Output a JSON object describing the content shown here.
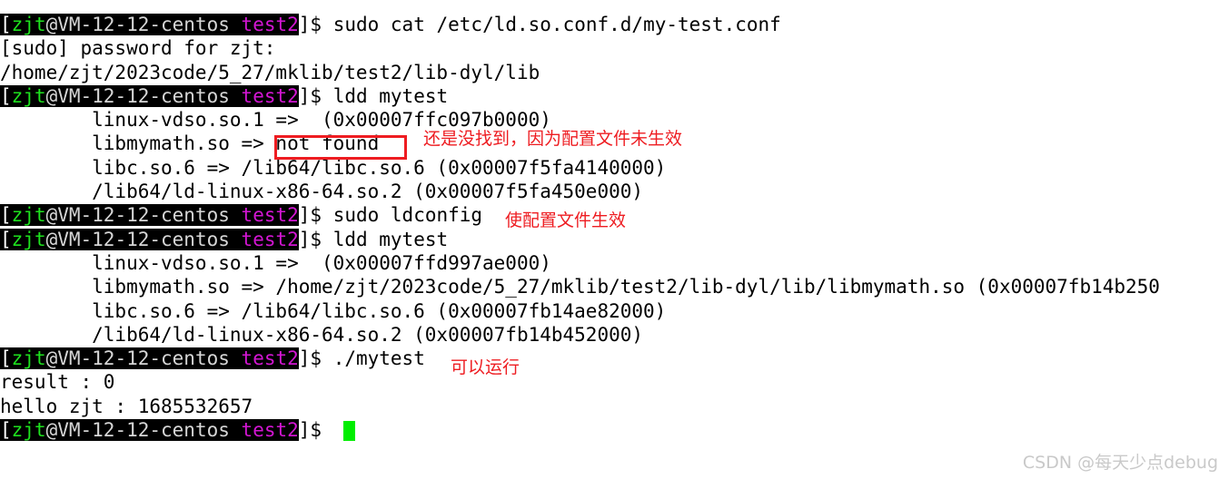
{
  "terminal": {
    "prompt": {
      "open_bracket": "[",
      "user": "zjt",
      "at_host": "@VM-12-12-centos",
      "space": " ",
      "dir": "test2",
      "tail": "]$ "
    },
    "colors": {
      "background": "#ffffff",
      "foreground": "#000000",
      "prompt_bg": "#000000",
      "prompt_user": "#1ee11e",
      "prompt_host": "#d6d6d6",
      "prompt_dir": "#d316d3",
      "prompt_bracket": "#ffffff",
      "cursor": "#00ee00",
      "annotation_red": "#ee1c21",
      "watermark": "#c9c9c9"
    },
    "clipped_top_line": "",
    "lines": [
      {
        "type": "command",
        "command": "sudo cat /etc/ld.so.conf.d/my-test.conf"
      },
      {
        "type": "output",
        "text": "[sudo] password for zjt:"
      },
      {
        "type": "output",
        "text": "/home/zjt/2023code/5_27/mklib/test2/lib-dyl/lib"
      },
      {
        "type": "command",
        "command": "ldd mytest"
      },
      {
        "type": "output",
        "text": "        linux-vdso.so.1 =>  (0x00007ffc097b0000)"
      },
      {
        "type": "output",
        "text": "        libmymath.so => not found"
      },
      {
        "type": "output",
        "text": "        libc.so.6 => /lib64/libc.so.6 (0x00007f5fa4140000)"
      },
      {
        "type": "output",
        "text": "        /lib64/ld-linux-x86-64.so.2 (0x00007f5fa450e000)"
      },
      {
        "type": "command",
        "command": "sudo ldconfig"
      },
      {
        "type": "command",
        "command": "ldd mytest"
      },
      {
        "type": "output",
        "text": "        linux-vdso.so.1 =>  (0x00007ffd997ae000)"
      },
      {
        "type": "output",
        "text": "        libmymath.so => /home/zjt/2023code/5_27/mklib/test2/lib-dyl/lib/libmymath.so (0x00007fb14b250"
      },
      {
        "type": "output",
        "text": "        libc.so.6 => /lib64/libc.so.6 (0x00007fb14ae82000)"
      },
      {
        "type": "output",
        "text": "        /lib64/ld-linux-x86-64.so.2 (0x00007fb14b452000)"
      },
      {
        "type": "command",
        "command": "./mytest"
      },
      {
        "type": "output",
        "text": "result : 0"
      },
      {
        "type": "output",
        "text": "hello zjt : 1685532657"
      },
      {
        "type": "command",
        "command": ""
      }
    ]
  },
  "annotations": [
    {
      "name": "not-found-note",
      "text": "还是没找到，因为配置文件未生效"
    },
    {
      "name": "ldconfig-note",
      "text": "使配置文件生效"
    },
    {
      "name": "run-ok-note",
      "text": "可以运行"
    }
  ],
  "watermark": {
    "text": "CSDN @每天少点debug"
  }
}
